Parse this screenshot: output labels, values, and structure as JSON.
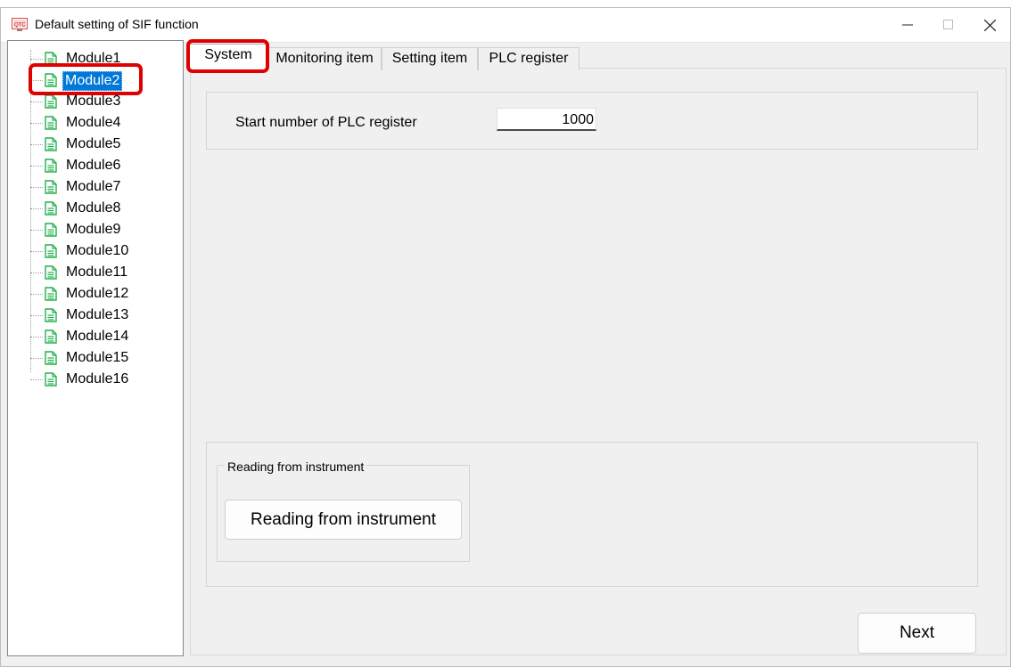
{
  "window": {
    "title": "Default setting of SIF function",
    "min_symbol": "—",
    "max_symbol": "☐",
    "close_symbol": "✕"
  },
  "tree": {
    "items": [
      {
        "label": "Module1"
      },
      {
        "label": "Module2",
        "selected": true
      },
      {
        "label": "Module3"
      },
      {
        "label": "Module4"
      },
      {
        "label": "Module5"
      },
      {
        "label": "Module6"
      },
      {
        "label": "Module7"
      },
      {
        "label": "Module8"
      },
      {
        "label": "Module9"
      },
      {
        "label": "Module10"
      },
      {
        "label": "Module11"
      },
      {
        "label": "Module12"
      },
      {
        "label": "Module13"
      },
      {
        "label": "Module14"
      },
      {
        "label": "Module15"
      },
      {
        "label": "Module16"
      }
    ]
  },
  "tabs": [
    {
      "label": "System",
      "active": true
    },
    {
      "label": "Monitoring item"
    },
    {
      "label": "Setting item"
    },
    {
      "label": "PLC register"
    }
  ],
  "system": {
    "start_label": "Start number of PLC register",
    "start_value": "1000",
    "group_caption": "Reading from instrument",
    "read_button": "Reading from instrument"
  },
  "footer": {
    "next_button": "Next"
  },
  "colors": {
    "highlight": "#e00000",
    "selection": "#0078d7",
    "tree_icon": "#22b14c"
  }
}
